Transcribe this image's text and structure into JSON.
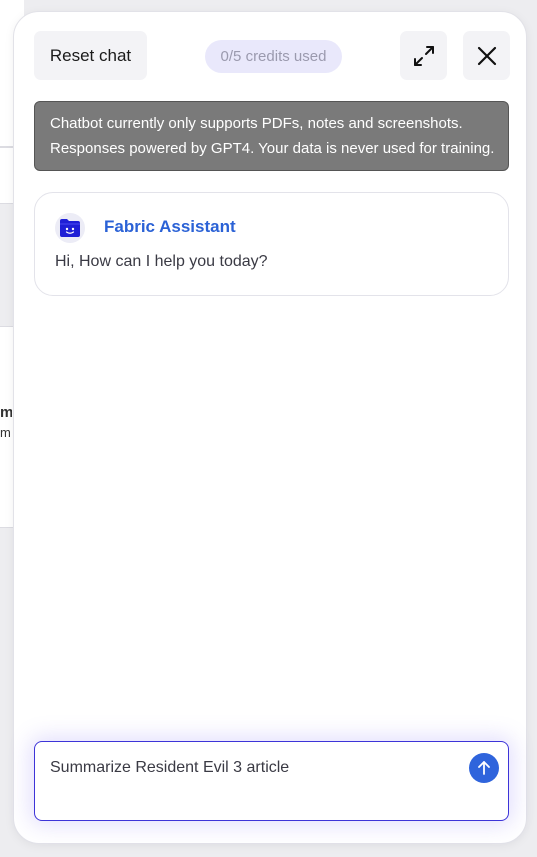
{
  "header": {
    "reset_label": "Reset chat",
    "credits_label": "0/5 credits used",
    "expand_icon": "expand-arrows-icon",
    "close_icon": "close-x-icon"
  },
  "notice": {
    "line1": "Chatbot currently only supports PDFs, notes and screenshots.",
    "line2": "Responses powered by GPT4. Your data is never used for training."
  },
  "messages": [
    {
      "sender": "Fabric Assistant",
      "avatar_icon": "folder-face-icon",
      "text": "Hi, How can I help you today?"
    }
  ],
  "composer": {
    "value": "Summarize Resident Evil 3 article",
    "send_icon": "arrow-up-icon"
  },
  "background": {
    "fragment_a": "m",
    "fragment_b": "m,"
  },
  "colors": {
    "accent": "#2f64dc",
    "assistant_name": "#2b62d6",
    "notice_bg": "#7a7a7a",
    "credits_bg": "#e9e8fb",
    "input_border": "#3d34d8"
  }
}
